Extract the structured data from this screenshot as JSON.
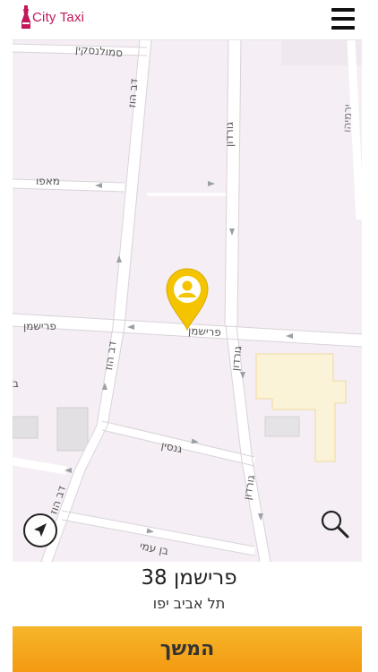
{
  "header": {
    "logo_text": "City Taxi",
    "menu_icon": "hamburger-menu-icon",
    "brand_color": "#c2185b"
  },
  "map": {
    "streets": {
      "smolenskin": "סמולנסקין",
      "dov_hoz_top": "דב הוז",
      "dov_hoz_mid": "דב הוז",
      "dov_hoz_bottom": "דב הוז",
      "mapu": "מאפו",
      "frishman_left": "פרישמן",
      "frishman_center": "פרישמן",
      "gordon_top": "גורדון",
      "gordon_mid": "גורדון",
      "gordon_bottom": "גורדון",
      "gnessin": "גנסין",
      "ben_ami": "בן עמי",
      "edge_right": "ירמיהו",
      "edge_left": "ב"
    },
    "pin_color": "#f5c400",
    "pin_icon": "user-pin-icon",
    "locate_icon": "navigation-arrow-icon",
    "search_icon": "magnifier-icon"
  },
  "address": {
    "street": "פרישמן 38",
    "city": "תל אביב יפו"
  },
  "actions": {
    "continue_label": "המשך",
    "continue_color": "#f4a61d"
  }
}
